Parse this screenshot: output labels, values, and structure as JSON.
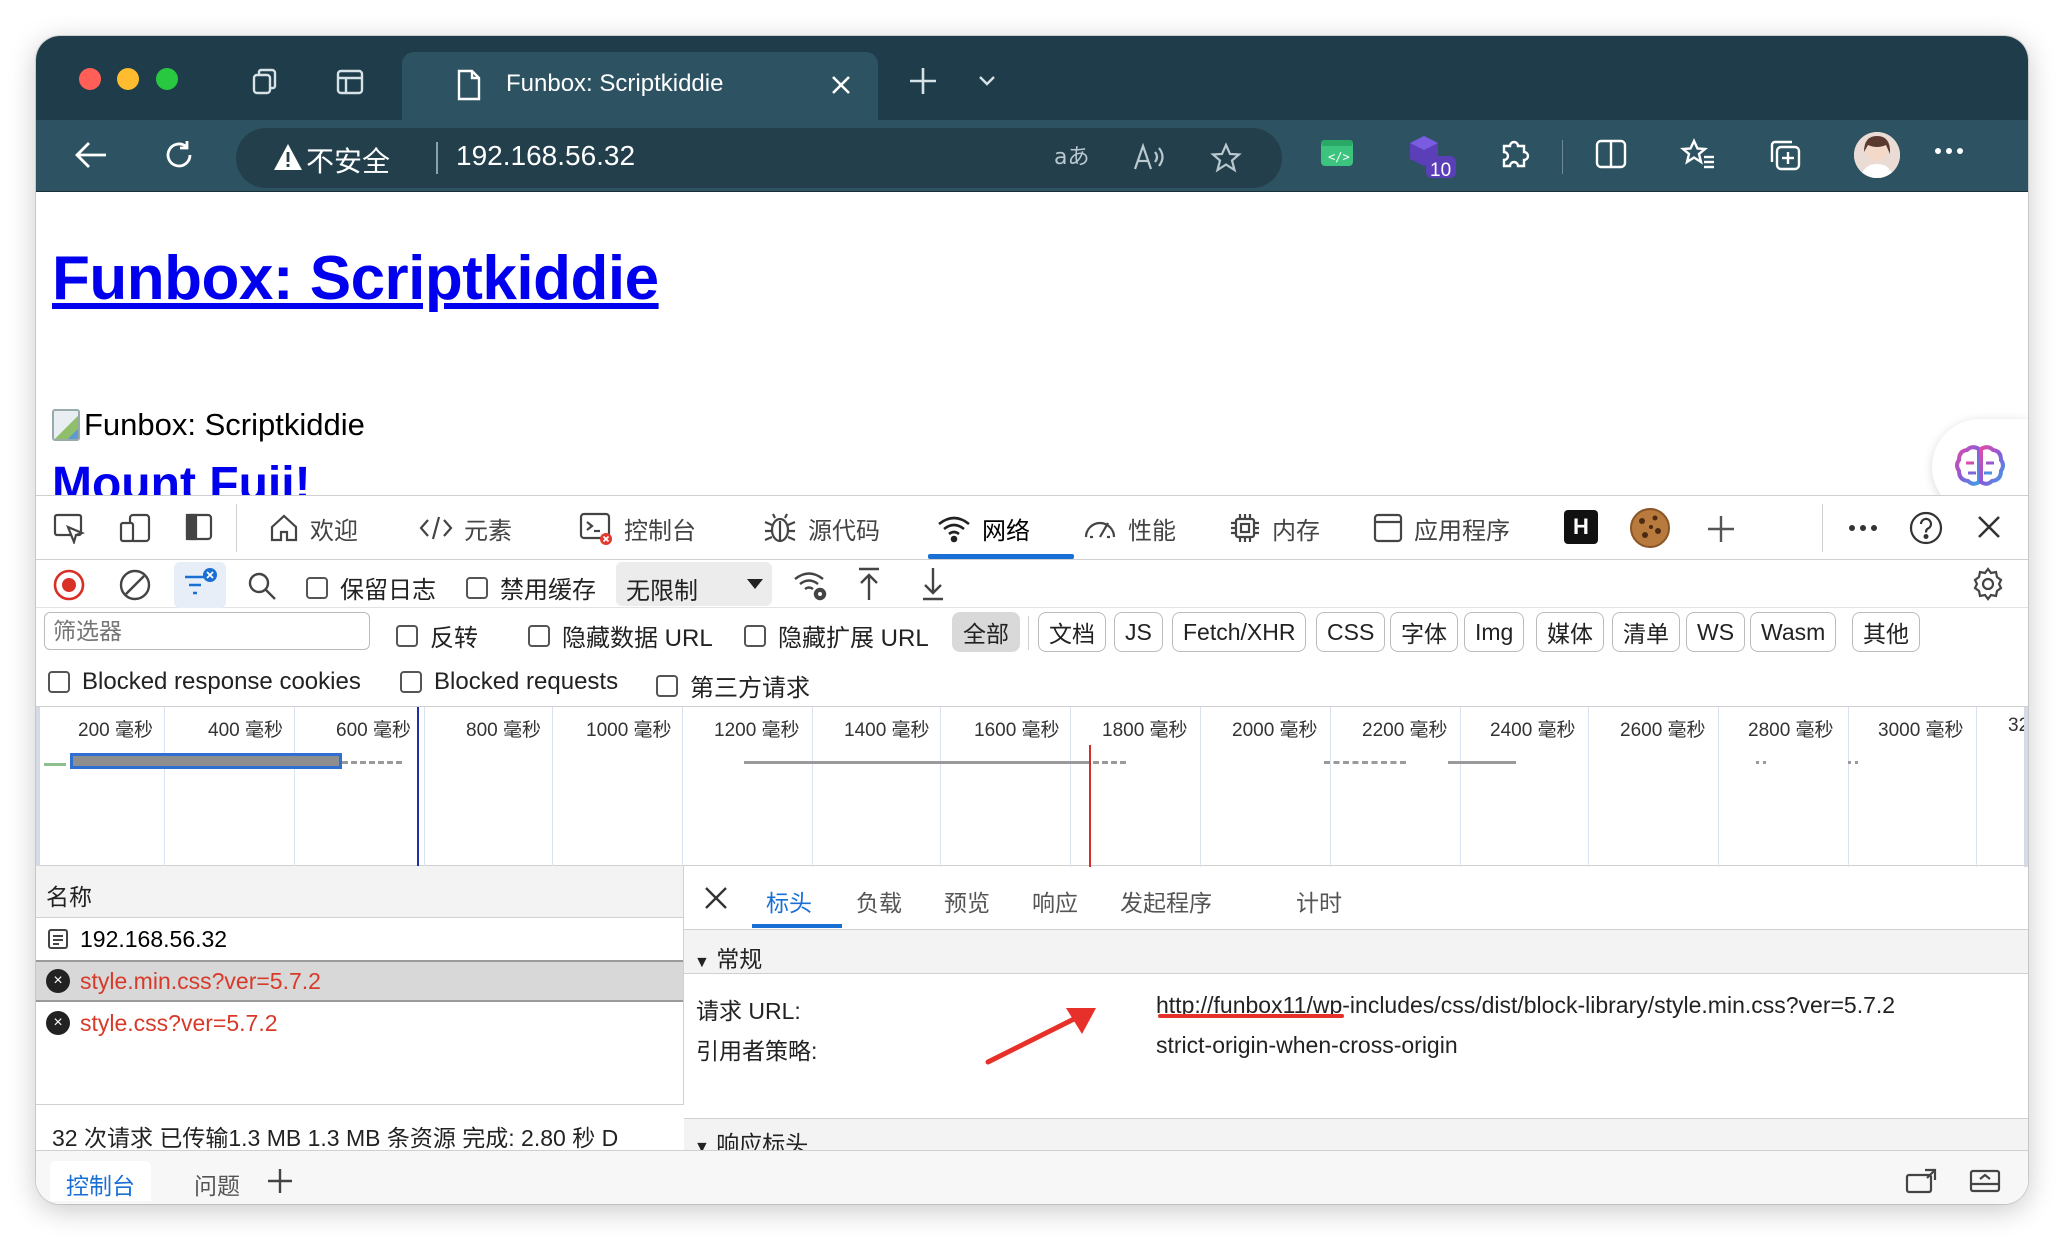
{
  "browser": {
    "tab_title": "Funbox: Scriptkiddie",
    "security_label": "不安全",
    "url": "192.168.56.32",
    "extension_badge": "10"
  },
  "page": {
    "heading": "Funbox: Scriptkiddie",
    "image_alt": "Funbox: Scriptkiddie",
    "subheading": "Mount Fuji!"
  },
  "devtools": {
    "tabs": [
      {
        "label": "欢迎"
      },
      {
        "label": "元素"
      },
      {
        "label": "控制台"
      },
      {
        "label": "源代码"
      },
      {
        "label": "网络"
      },
      {
        "label": "性能"
      },
      {
        "label": "内存"
      },
      {
        "label": "应用程序"
      }
    ],
    "toolbar": {
      "preserve_log": "保留日志",
      "disable_cache": "禁用缓存",
      "throttle": "无限制"
    },
    "filter": {
      "placeholder": "筛选器",
      "invert": "反转",
      "hide_data_urls": "隐藏数据 URL",
      "hide_ext_urls": "隐藏扩展 URL",
      "types": [
        "全部",
        "文档",
        "JS",
        "Fetch/XHR",
        "CSS",
        "字体",
        "Img",
        "媒体",
        "清单",
        "WS",
        "Wasm",
        "其他"
      ],
      "blocked_cookies": "Blocked response cookies",
      "blocked_requests": "Blocked requests",
      "third_party": "第三方请求"
    },
    "overview_ticks": [
      "200 毫秒",
      "400 毫秒",
      "600 毫秒",
      "800 毫秒",
      "1000 毫秒",
      "1200 毫秒",
      "1400 毫秒",
      "1600 毫秒",
      "1800 毫秒",
      "2000 毫秒",
      "2200 毫秒",
      "2400 毫秒",
      "2600 毫秒",
      "2800 毫秒",
      "3000 毫秒",
      "32"
    ],
    "requests": {
      "column_name": "名称",
      "rows": [
        {
          "name": "192.168.56.32",
          "status": "ok"
        },
        {
          "name": "style.min.css?ver=5.7.2",
          "status": "error"
        },
        {
          "name": "style.css?ver=5.7.2",
          "status": "error"
        }
      ],
      "summary": "32 次请求  已传输1.3 MB  1.3 MB 条资源  完成: 2.80 秒  D"
    },
    "detail": {
      "tabs": [
        "标头",
        "负载",
        "预览",
        "响应",
        "发起程序",
        "计时"
      ],
      "general_section": "常规",
      "request_url_key": "请求 URL:",
      "request_url_value": "http://funbox11/wp-includes/css/dist/block-library/style.min.css?ver=5.7.2",
      "referrer_policy_key": "引用者策略:",
      "referrer_policy_value": "strict-origin-when-cross-origin",
      "response_headers_section": "响应标头"
    },
    "drawer": {
      "tabs": [
        "控制台",
        "问题"
      ]
    }
  },
  "colors": {
    "titlebar": "#1e3c4a",
    "toolbar": "#2d5261",
    "link": "#0000ee",
    "accent": "#1a6fd4",
    "error": "#d83a2a",
    "annotation": "#e8302a"
  }
}
